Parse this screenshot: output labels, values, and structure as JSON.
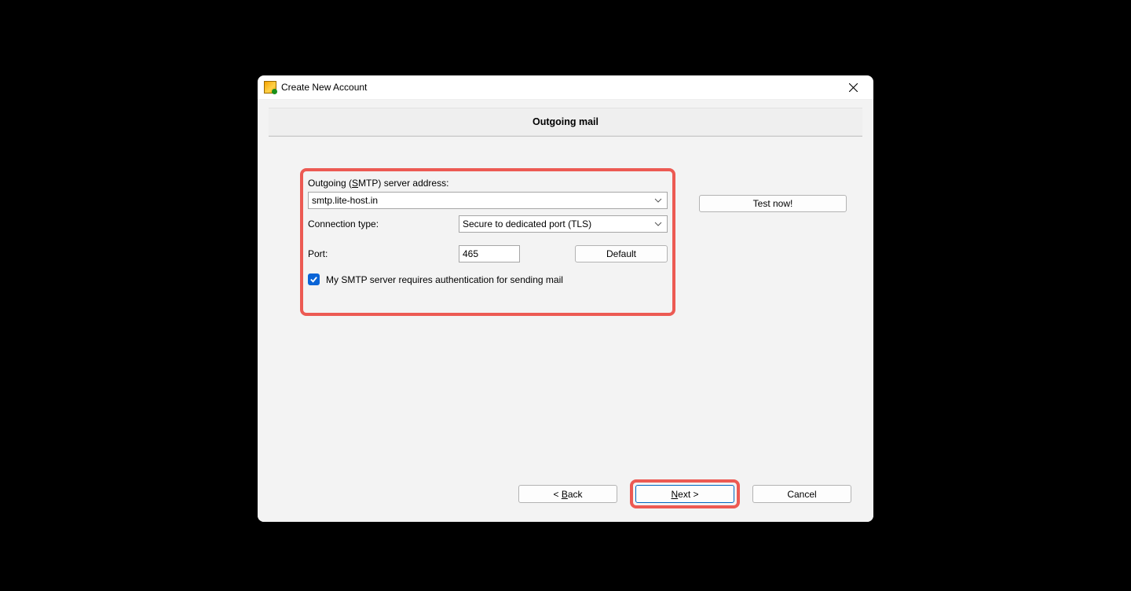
{
  "titlebar": {
    "title": "Create New Account"
  },
  "header": {
    "section_title": "Outgoing mail"
  },
  "form": {
    "smtp_label": "Outgoing (SMTP) server address:",
    "smtp_label_ul_char": "S",
    "smtp_value": "smtp.lite-host.in",
    "conn_label": "Connection type:",
    "conn_value": "Secure to dedicated port (TLS)",
    "port_label": "Port:",
    "port_value": "465",
    "default_btn": "Default",
    "auth_checkbox_label": "My SMTP server requires authentication for sending mail",
    "auth_checked": true
  },
  "actions": {
    "test_now": "Test now!"
  },
  "footer": {
    "back_prefix": "<  ",
    "back_ul": "B",
    "back_suffix": "ack",
    "next_ul": "N",
    "next_suffix": "ext   >",
    "cancel": "Cancel"
  }
}
